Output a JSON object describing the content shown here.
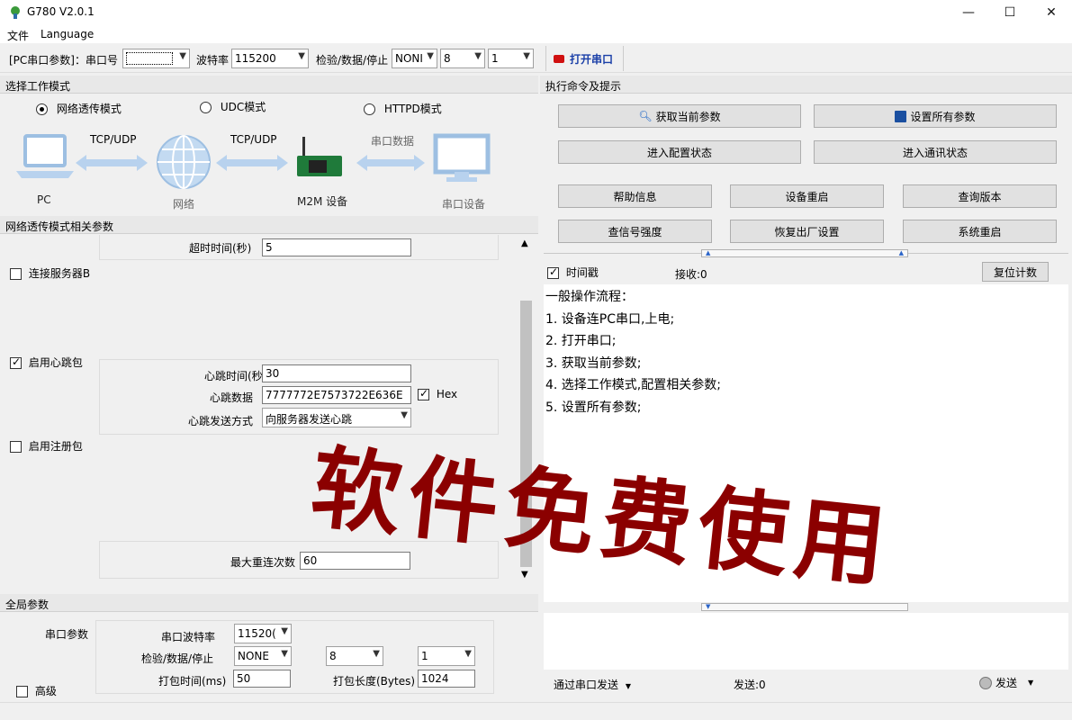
{
  "window": {
    "title": "G780 V2.0.1"
  },
  "menu": {
    "file": "文件",
    "language": "Language"
  },
  "toolbar": {
    "pc_params": "[PC串口参数]：串口号",
    "port_value": "",
    "baud_label": "波特率",
    "baud_value": "115200",
    "parity_label": "检验/数据/停止",
    "parity_value": "NONI",
    "data_value": "8",
    "stop_value": "1",
    "open_port": "打开串口"
  },
  "mode": {
    "header": "选择工作模式",
    "options": [
      "网络透传模式",
      "UDC模式",
      "HTTPD模式"
    ],
    "selected": 0,
    "diagram": {
      "pc": "PC",
      "proto1": "TCP/UDP",
      "network": "网络",
      "proto2": "TCP/UDP",
      "m2m": "M2M 设备",
      "serial_data": "串口数据",
      "serial_device": "串口设备"
    }
  },
  "net_params": {
    "header": "网络透传模式相关参数",
    "timeout_label": "超时时间(秒)",
    "timeout_value": "5",
    "connect_b": "连接服务器B",
    "heartbeat_enable": "启用心跳包",
    "heartbeat_time_label": "心跳时间(秒",
    "heartbeat_time_value": "30",
    "heartbeat_data_label": "心跳数据",
    "heartbeat_data_value": "7777772E7573722E636E",
    "hex_label": "Hex",
    "heartbeat_mode_label": "心跳发送方式",
    "heartbeat_mode_value": "向服务器发送心跳",
    "register_enable": "启用注册包",
    "max_reconnect_label": "最大重连次数",
    "max_reconnect_value": "60"
  },
  "global": {
    "header": "全局参数",
    "serial_params": "串口参数",
    "advanced": "高级",
    "baud_label": "串口波特率",
    "baud_value": "11520(",
    "parity_label": "检验/数据/停止",
    "parity_value": "NONE",
    "data_value": "8",
    "stop_value": "1",
    "pack_time_label": "打包时间(ms)",
    "pack_time_value": "50",
    "pack_len_label": "打包长度(Bytes)",
    "pack_len_value": "1024"
  },
  "commands": {
    "header": "执行命令及提示",
    "get_params": "获取当前参数",
    "set_params": "设置所有参数",
    "enter_config": "进入配置状态",
    "enter_comm": "进入通讯状态",
    "help": "帮助信息",
    "reboot_device": "设备重启",
    "query_version": "查询版本",
    "signal": "查信号强度",
    "factory_reset": "恢复出厂设置",
    "system_reboot": "系统重启"
  },
  "log": {
    "timestamp_label": "时间戳",
    "recv_label": "接收:0",
    "reset_count": "复位计数",
    "lines": [
      "一般操作流程：",
      "1. 设备连PC串口,上电;",
      "2. 打开串口;",
      "3. 获取当前参数;",
      "4. 选择工作模式,配置相关参数;",
      "5. 设置所有参数;"
    ]
  },
  "send": {
    "via_serial": "通过串口发送",
    "sent_label": "发送:0",
    "send_button": "发送"
  },
  "watermark": "软件免费使用",
  "colors": {
    "accent": "#1a64c8",
    "watermark": "#8b0000",
    "diagram_blue": "#a9c8e8"
  }
}
